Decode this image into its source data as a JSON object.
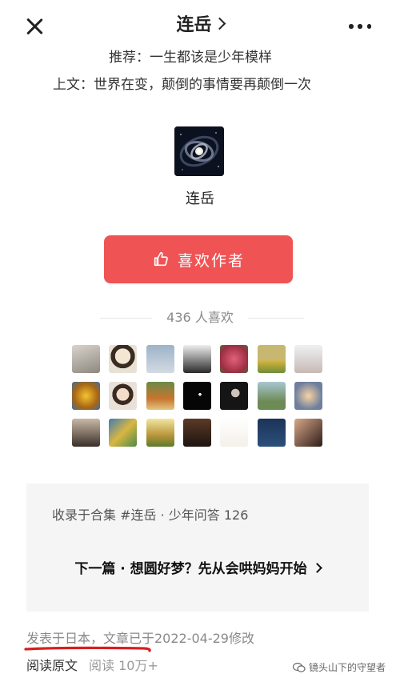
{
  "header": {
    "title": "连岳"
  },
  "recommend": {
    "label": "推荐：",
    "value": "一生都该是少年模样"
  },
  "previous": {
    "label": "上文：",
    "value": "世界在变，颠倒的事情要再颠倒一次"
  },
  "author": {
    "name": "连岳",
    "avatar_icon": "galaxy-image"
  },
  "like_button": {
    "label": "喜欢作者",
    "icon": "thumbs-up-icon",
    "color": "#f05354"
  },
  "likes": {
    "count": "436",
    "suffix": "人喜欢"
  },
  "fans": {
    "rows": 3,
    "per_row": 7
  },
  "collection": {
    "text": "收录于合集 #连岳 · 少年问答 126",
    "next_label": "下一篇 · 想圆好梦？先从会哄妈妈开始"
  },
  "footer": {
    "published": "发表于日本，文章已于2022-04-29修改",
    "original_link": "阅读原文",
    "reads": "阅读 10万+",
    "watermark": "镜头山下的守望者",
    "accent_red": "#d91f1f"
  }
}
